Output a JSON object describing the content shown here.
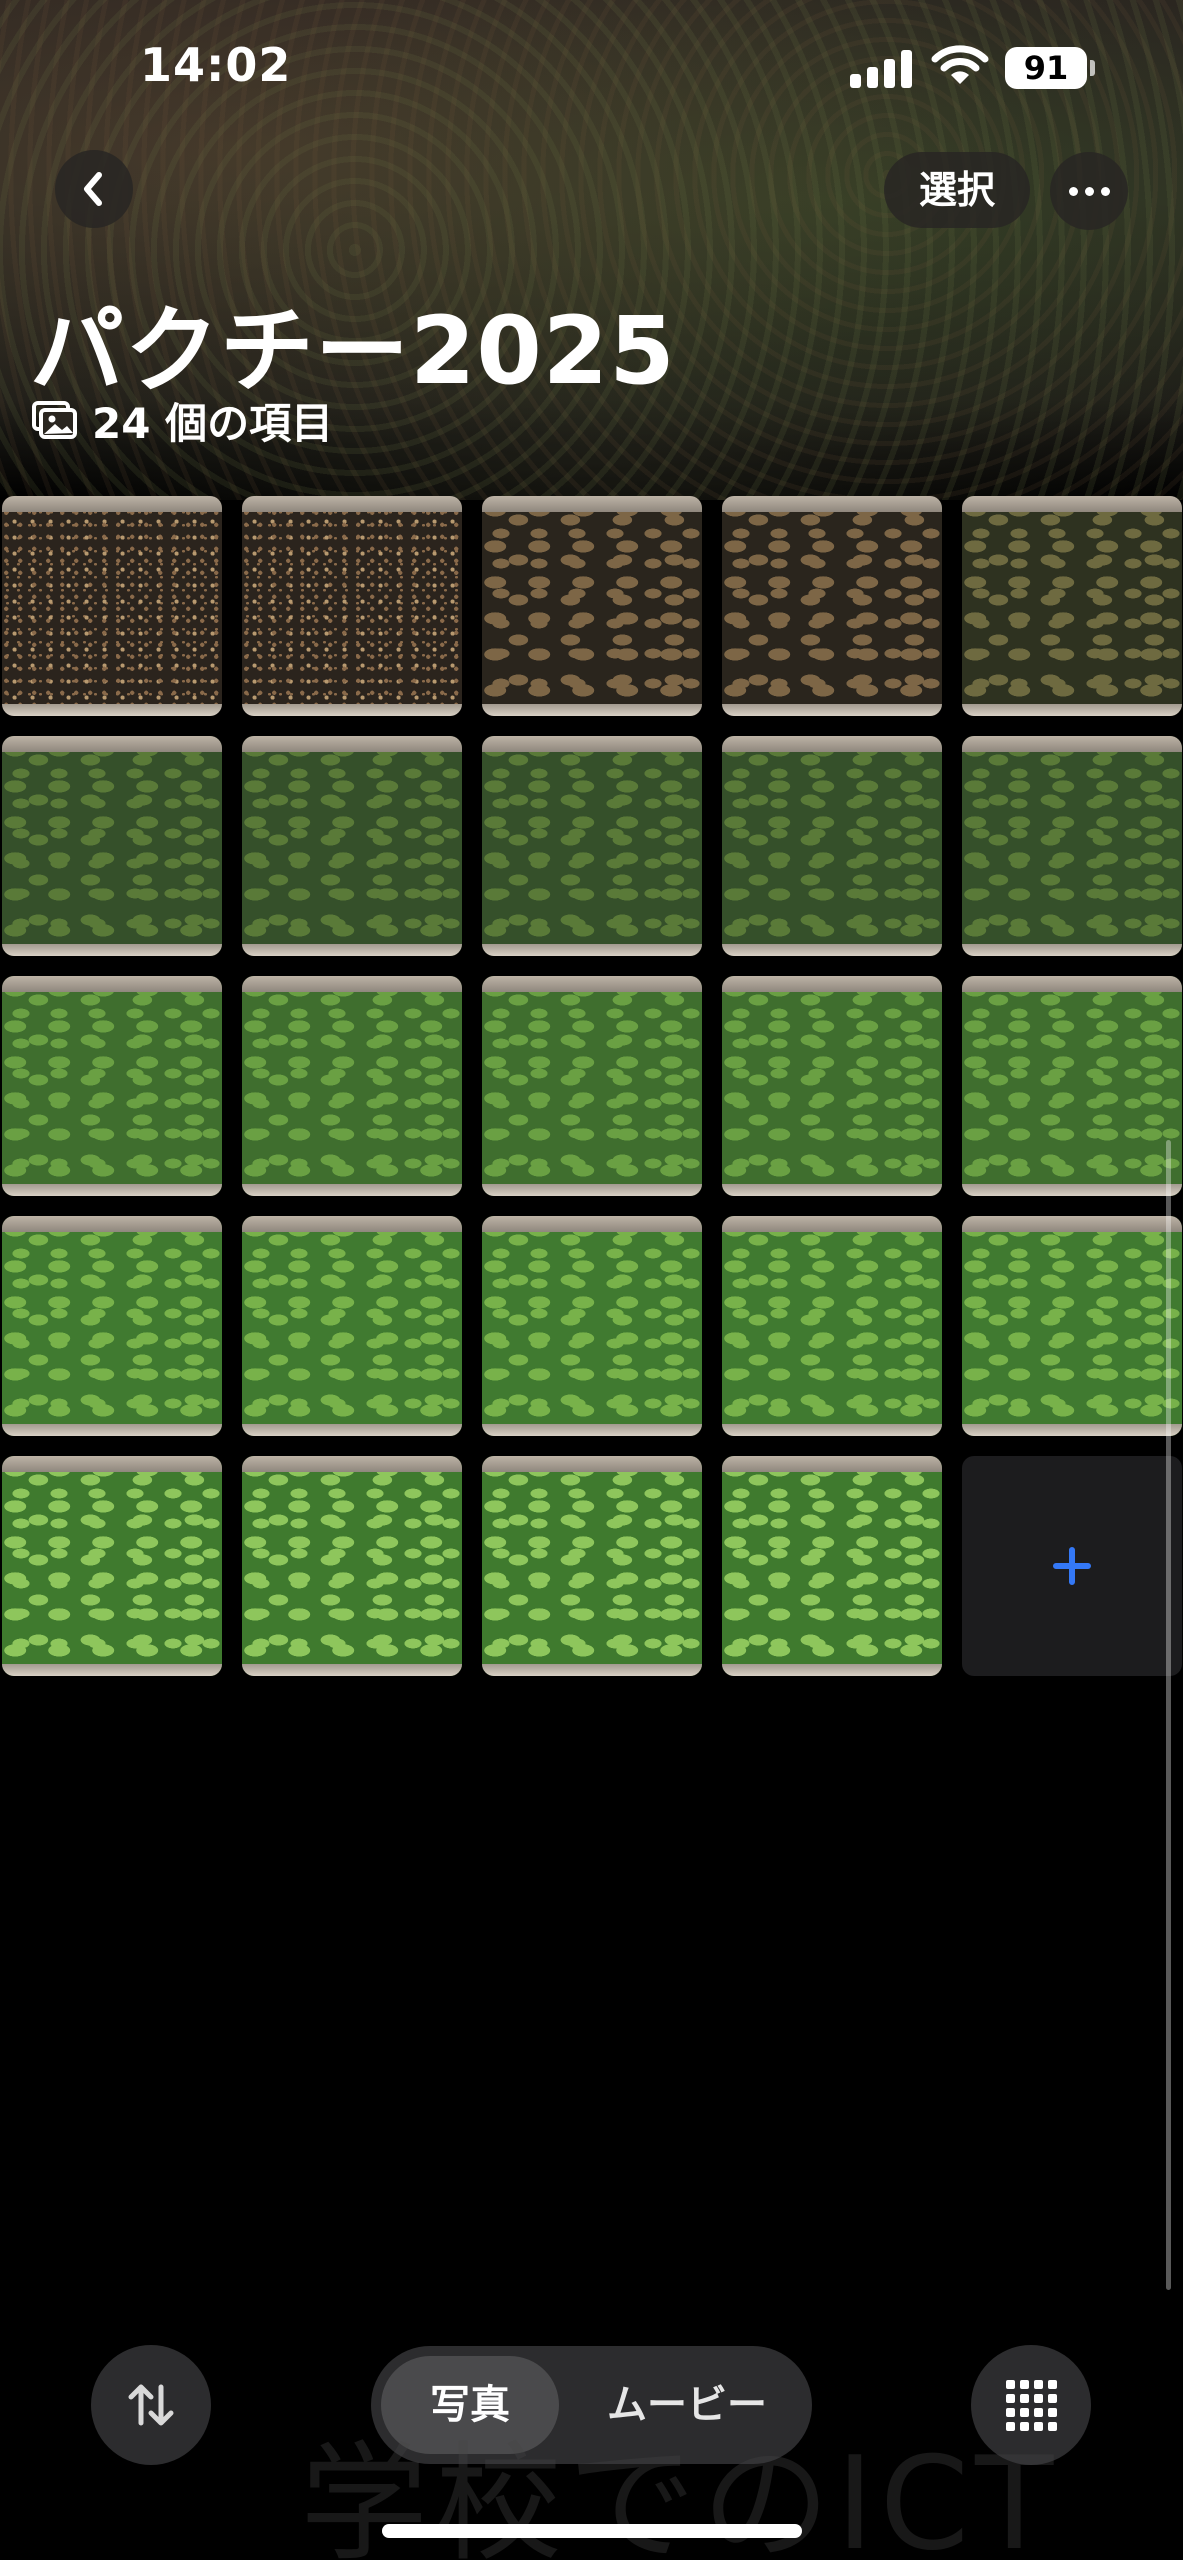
{
  "status_bar": {
    "time": "14:02",
    "battery": "91",
    "icons": [
      "signal-icon",
      "wifi-icon",
      "battery-icon"
    ]
  },
  "nav": {
    "back_icon": "chevron-left-icon",
    "select_label": "選択",
    "more_icon": "ellipsis-icon"
  },
  "album": {
    "title": "パクチー2025",
    "count_icon": "photo-stack-icon",
    "count_label": "24 個の項目"
  },
  "grid": {
    "columns": 5,
    "photos": [
      {
        "stage": "soil"
      },
      {
        "stage": "soil"
      },
      {
        "stage": "sprout-small"
      },
      {
        "stage": "sprout-small"
      },
      {
        "stage": "sprout"
      },
      {
        "stage": "seedling"
      },
      {
        "stage": "seedling"
      },
      {
        "stage": "seedling"
      },
      {
        "stage": "seedling"
      },
      {
        "stage": "seedling"
      },
      {
        "stage": "young"
      },
      {
        "stage": "young"
      },
      {
        "stage": "young"
      },
      {
        "stage": "young"
      },
      {
        "stage": "young"
      },
      {
        "stage": "leafy"
      },
      {
        "stage": "leafy"
      },
      {
        "stage": "leafy"
      },
      {
        "stage": "leafy"
      },
      {
        "stage": "leafy"
      },
      {
        "stage": "mature"
      },
      {
        "stage": "mature"
      },
      {
        "stage": "mature"
      },
      {
        "stage": "mature"
      }
    ],
    "add_icon": "plus-icon",
    "add_color": "#3478f6"
  },
  "bottom_bar": {
    "sort_icon": "sort-arrows-icon",
    "tab_photo": "写真",
    "tab_movie": "ムービー",
    "grid_icon": "grid-icon"
  },
  "watermark": "学校でのICT"
}
